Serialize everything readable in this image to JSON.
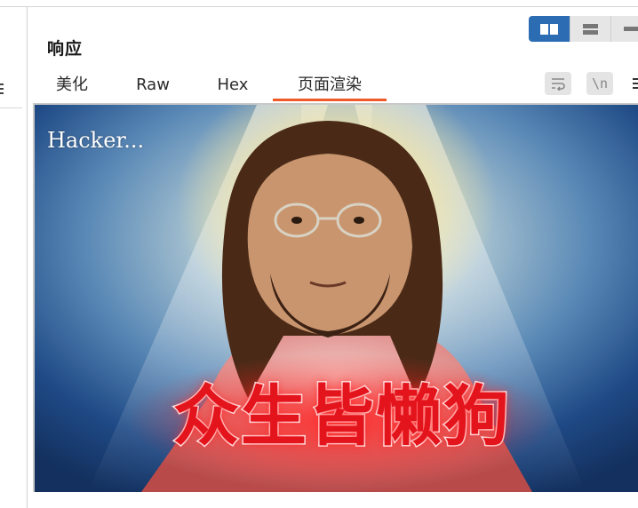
{
  "panel": {
    "title": "响应"
  },
  "layout_switch": {
    "options": [
      "split-columns-icon",
      "split-rows-icon",
      "single-view-icon"
    ]
  },
  "tabs": [
    {
      "label": "美化",
      "active": false
    },
    {
      "label": "Raw",
      "active": false
    },
    {
      "label": "Hex",
      "active": false
    },
    {
      "label": "页面渲染",
      "active": true
    }
  ],
  "toolbar": {
    "newline_label": "\\n"
  },
  "render": {
    "caption": "Hacker...",
    "overlay_text": "众生皆懒狗"
  },
  "colors": {
    "accent_tab_underline": "#f05a28",
    "layout_active": "#2b6cb3",
    "overlay_text": "#e4141c"
  }
}
